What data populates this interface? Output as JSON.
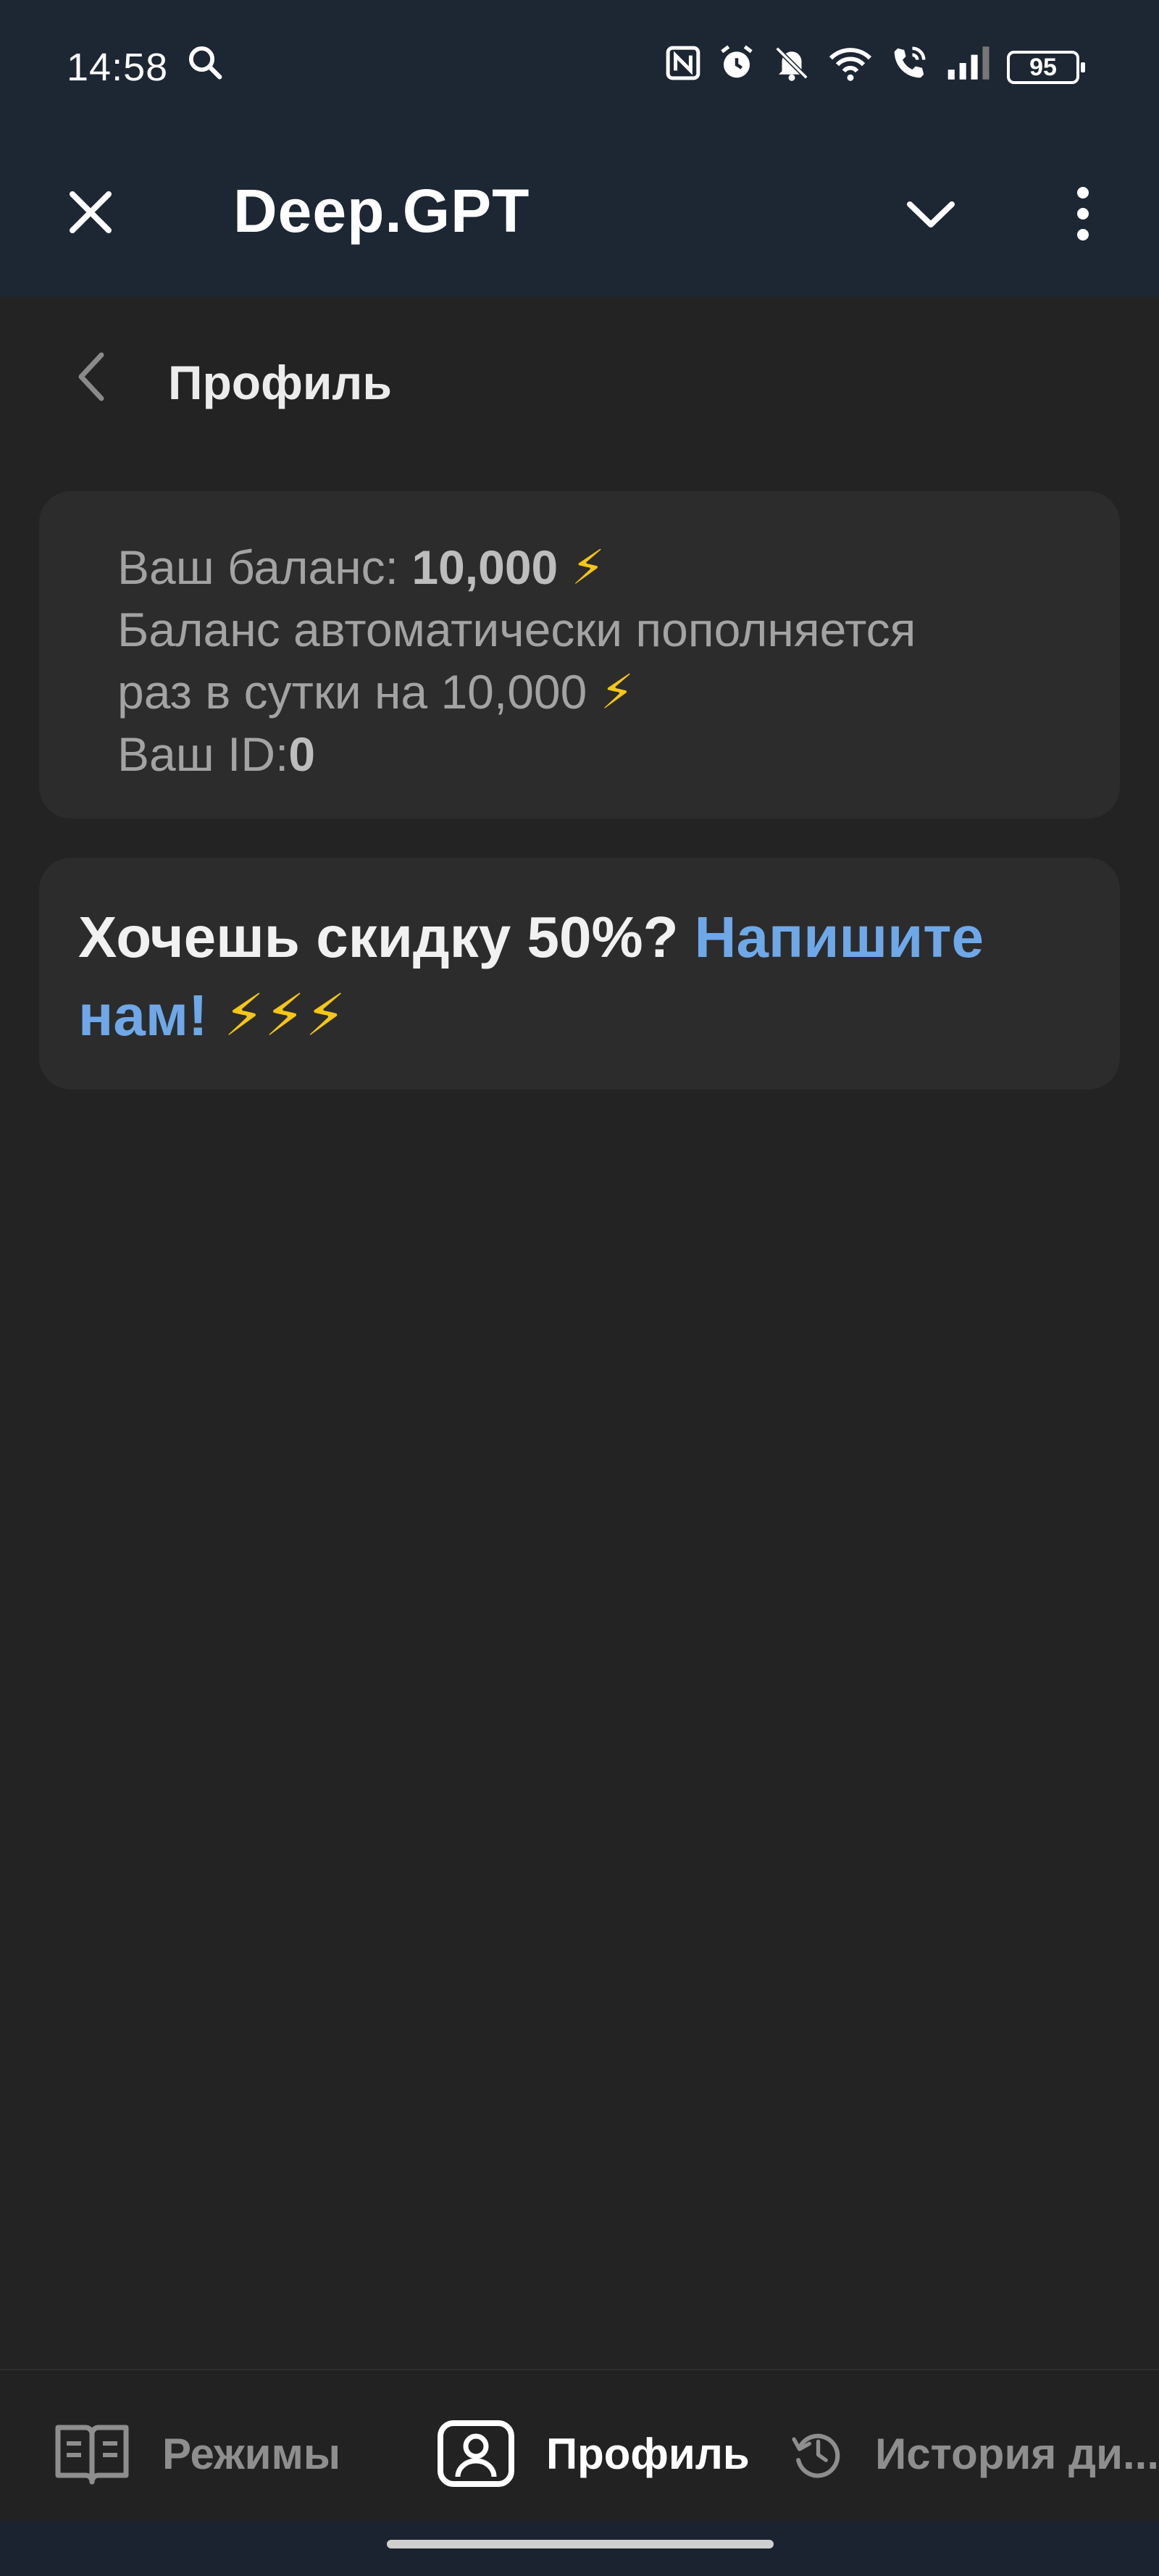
{
  "status_bar": {
    "time": "14:58",
    "battery": "95",
    "icons": [
      "search-icon",
      "nfc-icon",
      "alarm-icon",
      "bell-off-icon",
      "wifi-icon",
      "wifi-call-icon",
      "signal-icon",
      "battery-icon"
    ]
  },
  "header": {
    "title": "Deep.GPT",
    "icons": [
      "close-icon",
      "chevron-down-icon",
      "more-vertical-icon"
    ]
  },
  "page": {
    "title": "Профиль",
    "back_icon": "chevron-left-icon"
  },
  "balance_card": {
    "balance_label": "Ваш баланс: ",
    "balance_value": "10,000",
    "refill_line_1": "Баланс автоматически пополняется",
    "refill_line_2": "раз в сутки на 10,000",
    "id_label": "Ваш ID:",
    "id_value": "0",
    "bolt": "⚡"
  },
  "promo_card": {
    "text": "Хочешь скидку 50%? ",
    "link": "Напишите нам!",
    "bolts": "⚡⚡⚡"
  },
  "bottom_nav": {
    "items": [
      {
        "label": "Режимы",
        "icon": "book-icon",
        "active": false
      },
      {
        "label": "Профиль",
        "icon": "profile-icon",
        "active": true
      },
      {
        "label": "История ди...",
        "icon": "history-icon",
        "active": false
      }
    ]
  },
  "colors": {
    "header_bg": "#1d2633",
    "page_bg": "#232323",
    "card_bg": "#2c2c2c",
    "link": "#6ea8e8",
    "bolt": "#f5c518"
  }
}
